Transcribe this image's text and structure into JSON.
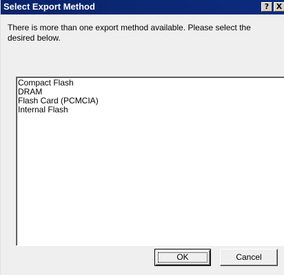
{
  "window": {
    "title": "Select Export Method",
    "help_glyph": "?",
    "close_glyph": "X"
  },
  "message": "There is more than one export method available. Please select the desired below.",
  "export_methods": [
    "Compact Flash",
    "DRAM",
    "Flash Card (PCMCIA)",
    "Internal Flash"
  ],
  "buttons": {
    "ok_label": "OK",
    "cancel_label": "Cancel"
  },
  "colors": {
    "titlebar": "#0a246a",
    "dialog_background": "#efefef",
    "list_background": "#ffffff"
  },
  "icons": {
    "help": "help-icon",
    "close": "close-icon"
  }
}
